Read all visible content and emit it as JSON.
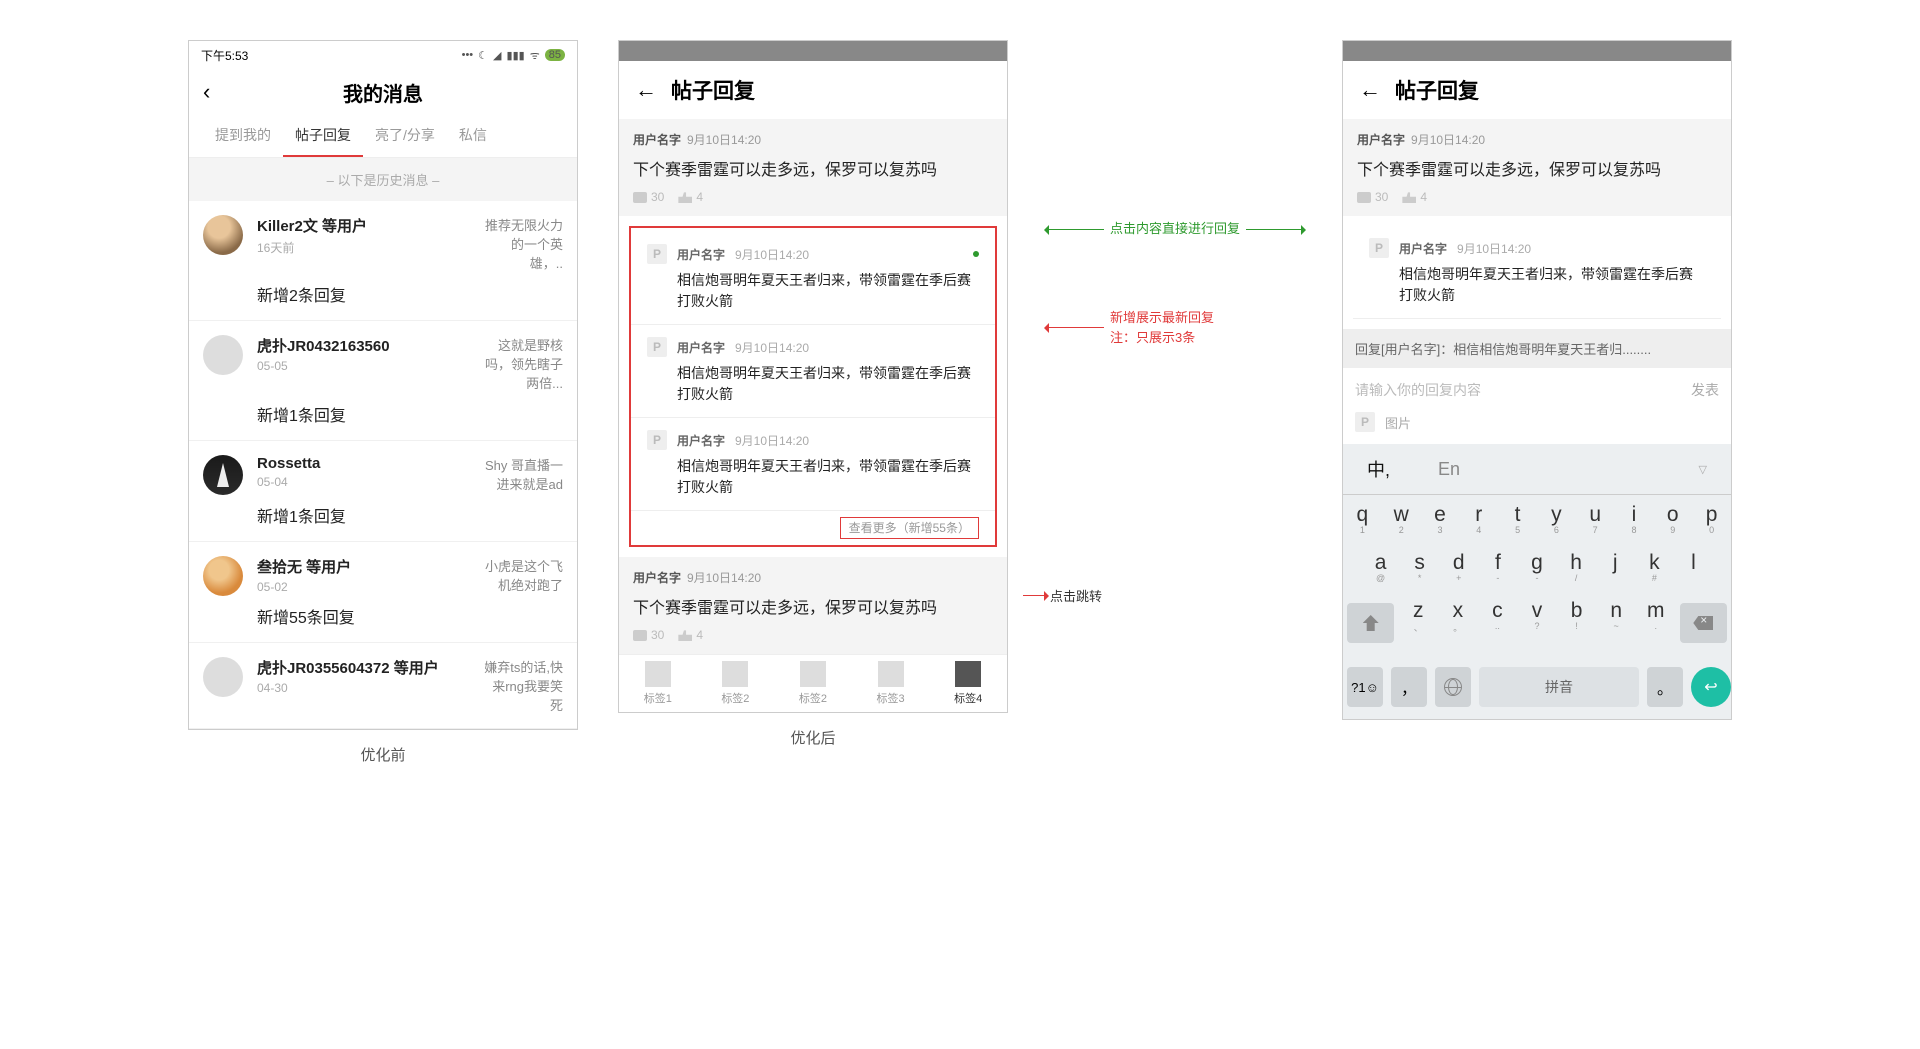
{
  "captions": {
    "before": "优化前",
    "after": "优化后"
  },
  "screen1": {
    "status_time": "下午5:53",
    "battery": "85",
    "title": "我的消息",
    "tabs": [
      "提到我的",
      "帖子回复",
      "亮了/分享",
      "私信"
    ],
    "history_label": "–  以下是历史消息  –",
    "items": [
      {
        "user": "Killer2文 等用户",
        "date": "16天前",
        "preview": "推荐无限火力的一个英雄，..",
        "count": "新增2条回复"
      },
      {
        "user": "虎扑JR0432163560",
        "date": "05-05",
        "preview": "这就是野核吗，领先瞎子两倍...",
        "count": "新增1条回复"
      },
      {
        "user": "Rossetta",
        "date": "05-04",
        "preview": "Shy 哥直播一进来就是ad",
        "count": "新增1条回复"
      },
      {
        "user": "叁拾无 等用户",
        "date": "05-02",
        "preview": "小虎是这个飞机绝对跑了",
        "count": "新增55条回复"
      },
      {
        "user": "虎扑JR0355604372 等用户",
        "date": "04-30",
        "preview": "嫌弃ts的话,快来rng我要笑死",
        "count": ""
      }
    ]
  },
  "screen2": {
    "title": "帖子回复",
    "post_user": "用户名字",
    "post_time": "9月10日14:20",
    "post_title": "下个赛季雷霆可以走多远，保罗可以复苏吗",
    "comments": "30",
    "likes": "4",
    "reply_user": "用户名字",
    "reply_time": "9月10日14:20",
    "reply_text": "相信炮哥明年夏天王者归来，带领雷霆在季后赛打败火箭",
    "more": "查看更多（新增55条）",
    "nav": [
      "标签1",
      "标签2",
      "标签2",
      "标签3",
      "标签4"
    ]
  },
  "annotations": {
    "green": "点击内容直接进行回复",
    "red": "新增展示最新回复\n注：只展示3条",
    "jump": "点击跳转"
  },
  "screen3": {
    "quoted": "回复[用户名字]：相信相信炮哥明年夏天王者归........",
    "placeholder": "请输入你的回复内容",
    "publish": "发表",
    "image_label": "图片",
    "lang_zh": "中,",
    "lang_en": "En",
    "space_label": "拼音"
  },
  "keyboard": {
    "row1": [
      [
        "q",
        "1"
      ],
      [
        "w",
        "2"
      ],
      [
        "e",
        "3"
      ],
      [
        "r",
        "4"
      ],
      [
        "t",
        "5"
      ],
      [
        "y",
        "6"
      ],
      [
        "u",
        "7"
      ],
      [
        "i",
        "8"
      ],
      [
        "o",
        "9"
      ],
      [
        "p",
        "0"
      ]
    ],
    "row2": [
      [
        "a",
        "@"
      ],
      [
        "s",
        "*"
      ],
      [
        "d",
        "+"
      ],
      [
        "f",
        "-"
      ],
      [
        "g",
        "-"
      ],
      [
        "h",
        "/"
      ],
      [
        "j",
        ""
      ],
      [
        "k",
        "#"
      ],
      [
        "l",
        ""
      ]
    ],
    "row3": [
      [
        "z",
        "、"
      ],
      [
        "x",
        "。"
      ],
      [
        "c",
        ".."
      ],
      [
        "v",
        "?"
      ],
      [
        "b",
        "!"
      ],
      [
        "n",
        "~"
      ],
      [
        "m",
        "."
      ]
    ],
    "sym": "?1☺",
    "comma": "，",
    "period": "。"
  }
}
